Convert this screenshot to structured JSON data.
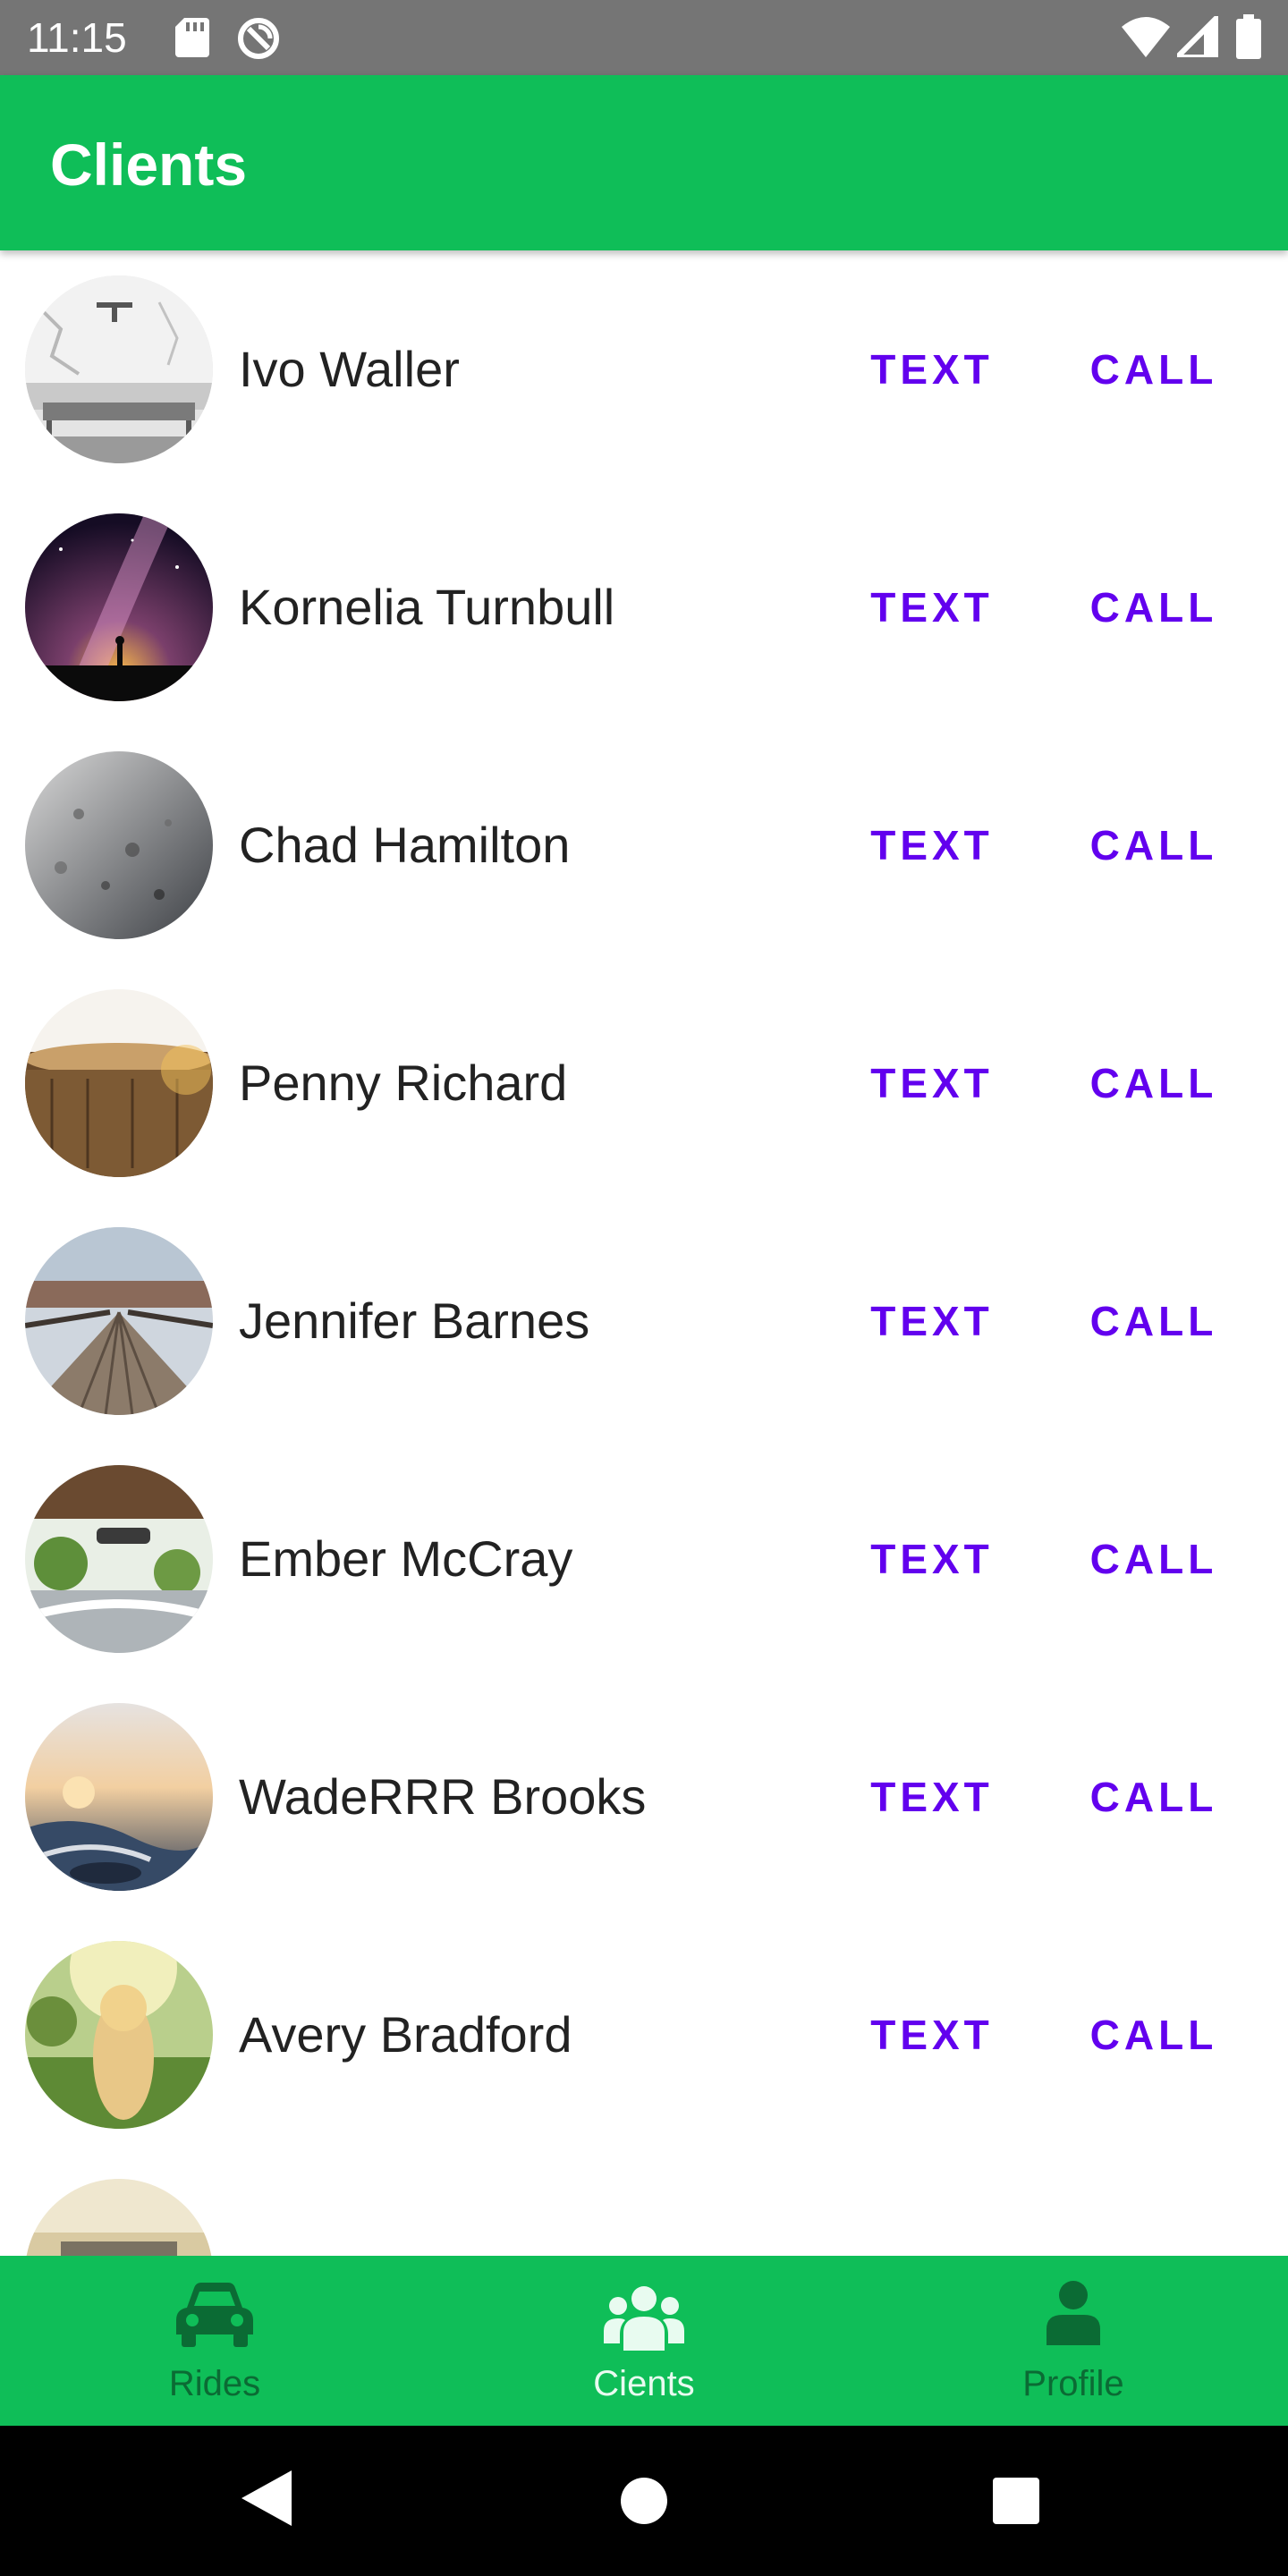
{
  "status_bar": {
    "time": "11:15",
    "icons": [
      "sd-card-icon",
      "sync-icon",
      "wifi-icon",
      "signal-icon",
      "battery-icon"
    ]
  },
  "app_bar": {
    "title": "Clients",
    "color": "#0fbe58"
  },
  "clients": [
    {
      "name": "Ivo Waller",
      "text_label": "TEXT",
      "call_label": "CALL"
    },
    {
      "name": "Kornelia Turnbull",
      "text_label": "TEXT",
      "call_label": "CALL"
    },
    {
      "name": "Chad Hamilton",
      "text_label": "TEXT",
      "call_label": "CALL"
    },
    {
      "name": "Penny Richard",
      "text_label": "TEXT",
      "call_label": "CALL"
    },
    {
      "name": "Jennifer Barnes",
      "text_label": "TEXT",
      "call_label": "CALL"
    },
    {
      "name": "Ember McCray",
      "text_label": "TEXT",
      "call_label": "CALL"
    },
    {
      "name": "WadeRRR Brooks",
      "text_label": "TEXT",
      "call_label": "CALL"
    },
    {
      "name": "Avery Bradford",
      "text_label": "TEXT",
      "call_label": "CALL"
    }
  ],
  "bottom_nav": {
    "items": [
      {
        "label": "Rides",
        "icon": "car-icon",
        "active": false
      },
      {
        "label": "Cients",
        "icon": "group-icon",
        "active": true
      },
      {
        "label": "Profile",
        "icon": "person-icon",
        "active": false
      }
    ]
  },
  "colors": {
    "accent": "#6200ee",
    "brand_green": "#0fbe58",
    "status_bar": "#757575"
  }
}
